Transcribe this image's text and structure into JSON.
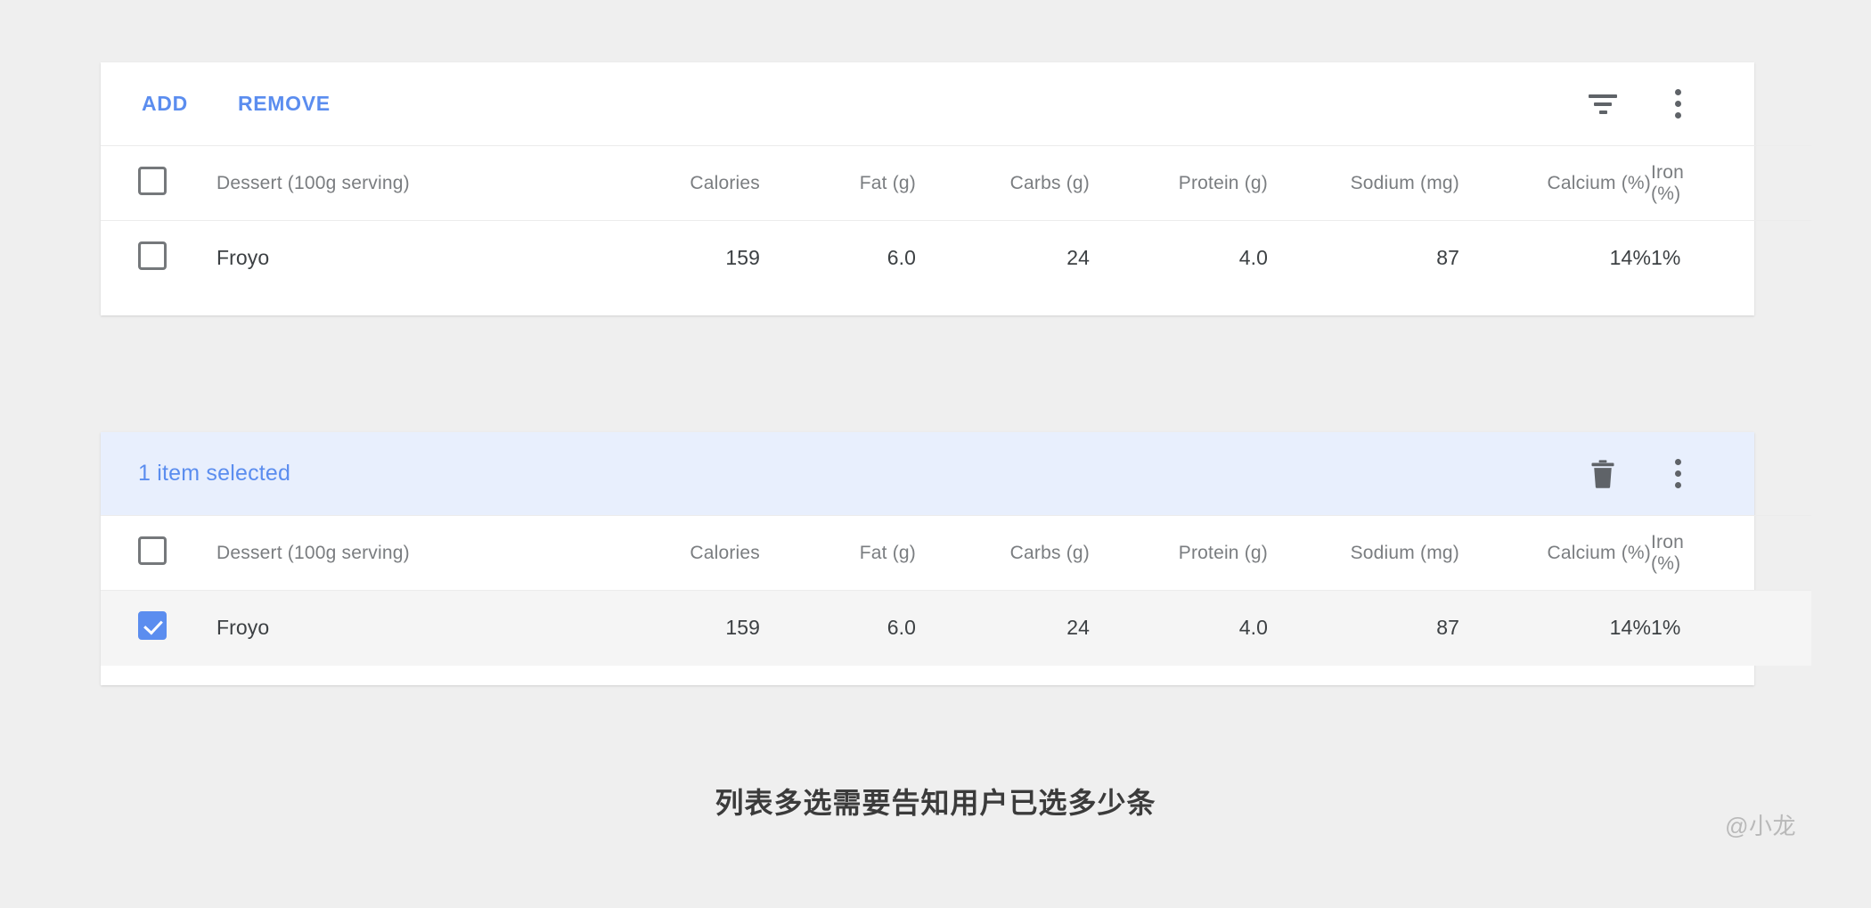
{
  "page": {
    "background_color": "#efefef",
    "caption": "列表多选需要告知用户已选多少条",
    "watermark": "@小龙"
  },
  "colors": {
    "accent_blue": "#5b8def",
    "selection_toolbar_bg": "#e8effd",
    "selected_row_bg": "#f5f5f5",
    "header_text": "#7a7d80",
    "body_text": "#3c4043",
    "icon_grey": "#5f6368"
  },
  "table_plain": {
    "toolbar": {
      "add_label": "ADD",
      "remove_label": "REMOVE",
      "filter_icon": "filter-icon",
      "menu_icon": "more-vert-icon"
    },
    "columns": [
      "Dessert (100g serving)",
      "Calories",
      "Fat (g)",
      "Carbs (g)",
      "Protein (g)",
      "Sodium (mg)",
      "Calcium (%)",
      "Iron (%)"
    ],
    "header_checkbox_checked": false,
    "rows": [
      {
        "checked": false,
        "dessert": "Froyo",
        "calories": "159",
        "fat": "6.0",
        "carbs": "24",
        "protein": "4.0",
        "sodium": "87",
        "calcium": "14%",
        "iron": "1%"
      }
    ]
  },
  "table_selected": {
    "toolbar": {
      "selection_label": "1 item selected",
      "delete_icon": "trash-icon",
      "menu_icon": "more-vert-icon"
    },
    "columns": [
      "Dessert (100g serving)",
      "Calories",
      "Fat (g)",
      "Carbs (g)",
      "Protein (g)",
      "Sodium (mg)",
      "Calcium (%)",
      "Iron (%)"
    ],
    "header_checkbox_checked": false,
    "rows": [
      {
        "checked": true,
        "dessert": "Froyo",
        "calories": "159",
        "fat": "6.0",
        "carbs": "24",
        "protein": "4.0",
        "sodium": "87",
        "calcium": "14%",
        "iron": "1%"
      }
    ]
  }
}
